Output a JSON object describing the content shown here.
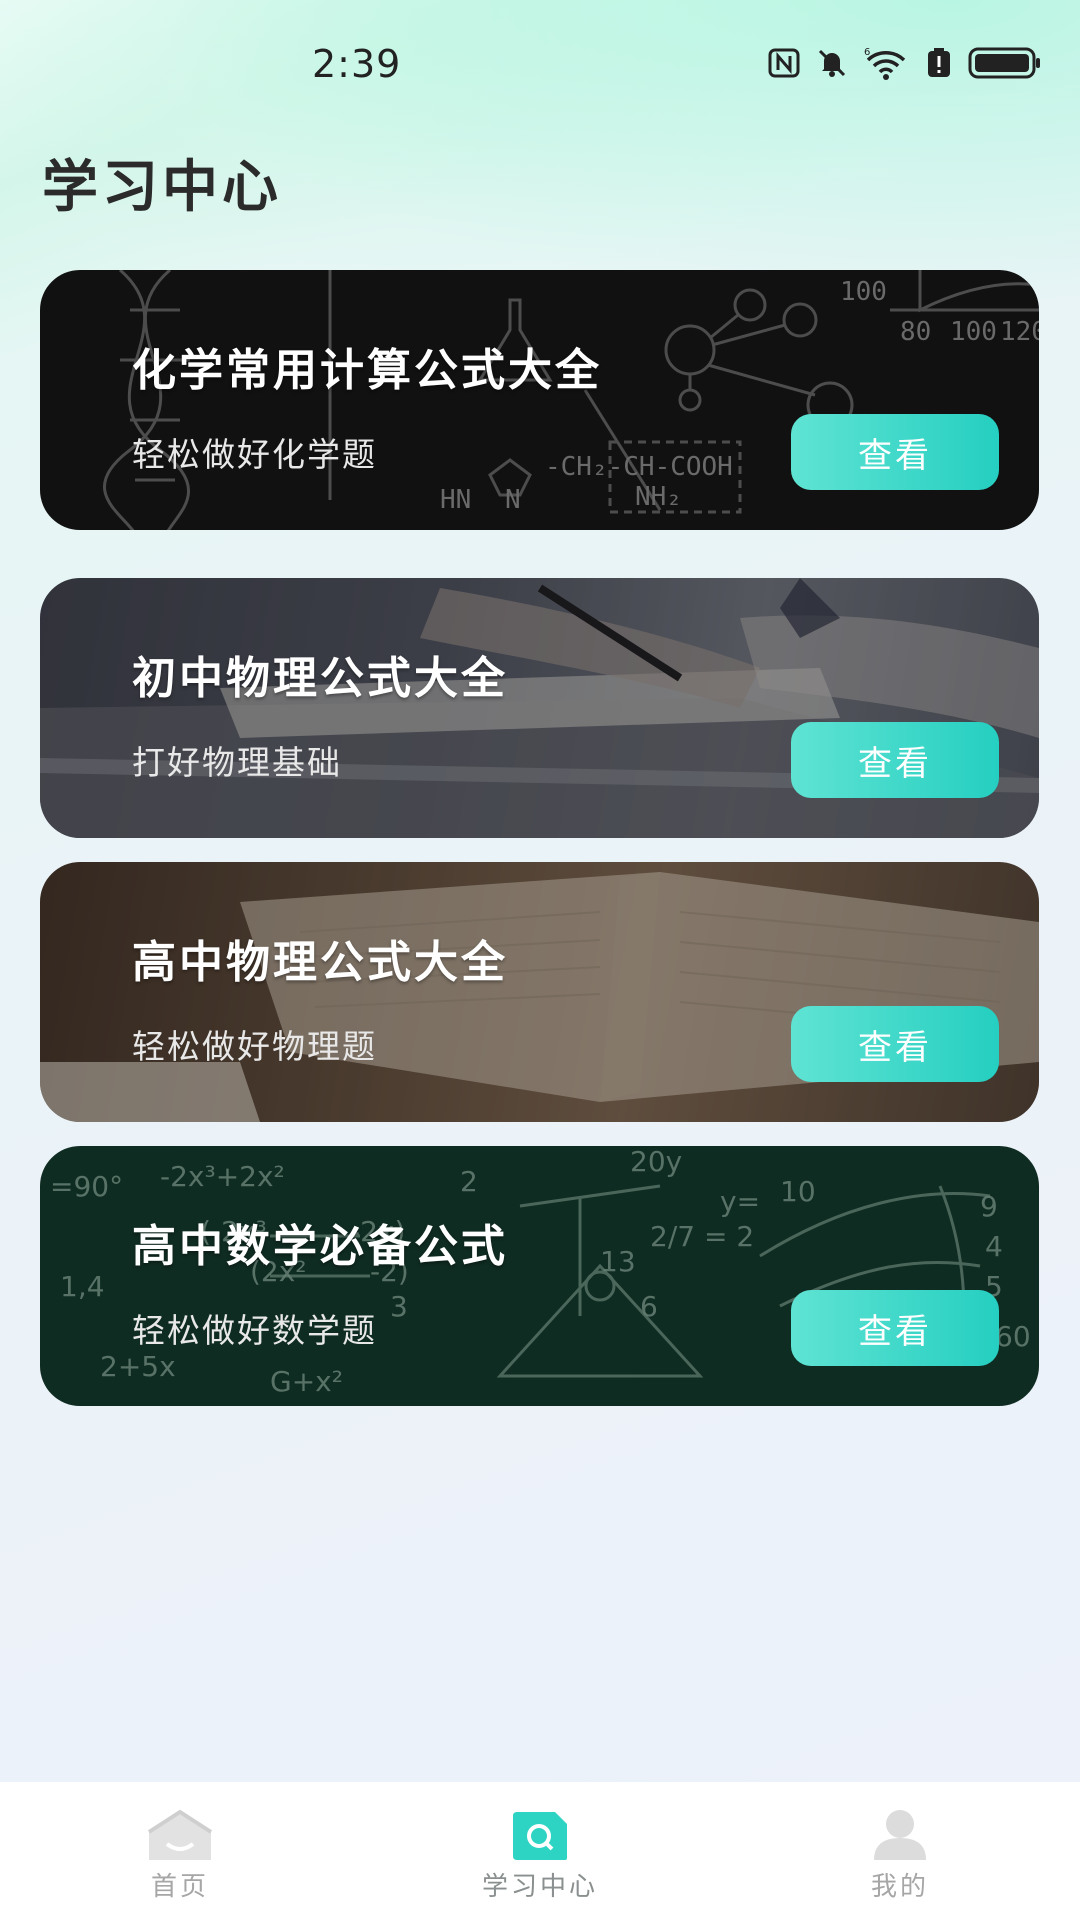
{
  "status_bar": {
    "time": "2:39",
    "icons": [
      "nfc-icon",
      "bell-muted-icon",
      "wifi-6-icon",
      "battery-alert-icon",
      "battery-icon"
    ]
  },
  "page": {
    "title": "学习中心"
  },
  "cards": [
    {
      "title": "化学常用计算公式大全",
      "subtitle": "轻松做好化学题",
      "button": "查看",
      "background": "chemistry-blackboard"
    },
    {
      "title": "初中物理公式大全",
      "subtitle": "打好物理基础",
      "button": "查看",
      "background": "student-writing-desk"
    },
    {
      "title": "高中物理公式大全",
      "subtitle": "轻松做好物理题",
      "button": "查看",
      "background": "open-textbook"
    },
    {
      "title": "高中数学必备公式",
      "subtitle": "轻松做好数学题",
      "button": "查看",
      "background": "math-greenboard"
    }
  ],
  "bottom_nav": {
    "items": [
      {
        "label": "首页",
        "icon": "home-icon"
      },
      {
        "label": "学习中心",
        "icon": "study-search-icon",
        "active": true
      },
      {
        "label": "我的",
        "icon": "user-icon"
      }
    ]
  },
  "colors": {
    "accent": "#2dd4c4",
    "button_gradient_start": "#5fe3d3",
    "button_gradient_end": "#25cfc1",
    "title_text": "#2b2b2b",
    "nav_inactive": "#a6a6a6"
  }
}
